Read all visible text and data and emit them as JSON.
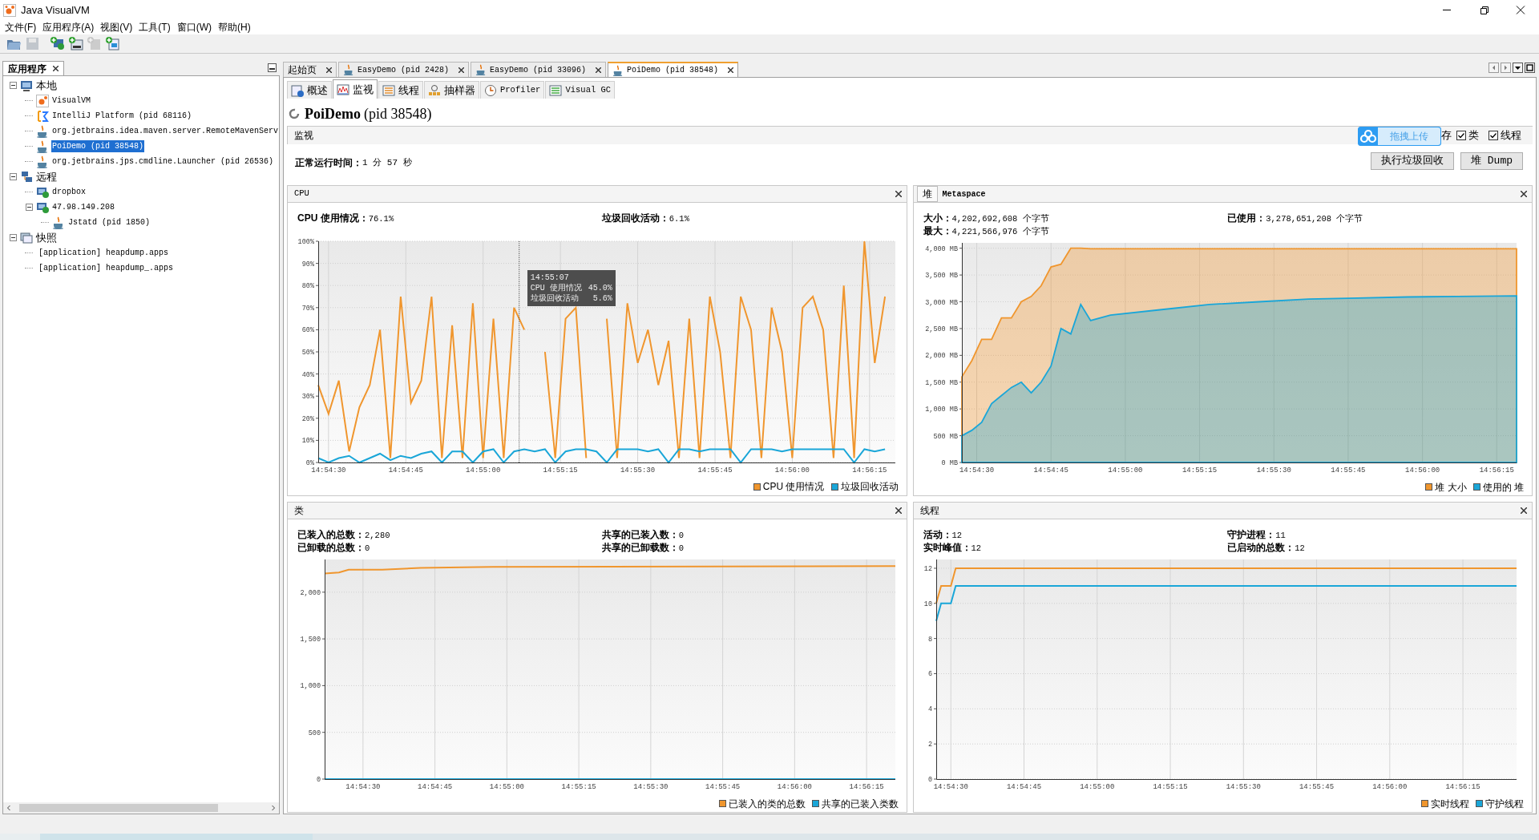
{
  "window": {
    "title": "Java VisualVM"
  },
  "menu": [
    "文件(F)",
    "应用程序(A)",
    "视图(V)",
    "工具(T)",
    "窗口(W)",
    "帮助(H)"
  ],
  "toolbar": [
    {
      "kind": "open",
      "disabled": false
    },
    {
      "kind": "save",
      "disabled": true
    },
    {
      "kind": "add-host",
      "disabled": false
    },
    {
      "kind": "add-jmx",
      "disabled": false
    },
    {
      "kind": "add-dump",
      "disabled": true
    },
    {
      "kind": "add-snapshot",
      "disabled": false
    }
  ],
  "sidebar": {
    "title": "应用程序",
    "tree": [
      {
        "label": "本地",
        "kind": "computer",
        "expanded": true,
        "selected": false,
        "children": [
          {
            "label": "VisualVM",
            "kind": "visualvm",
            "selected": false
          },
          {
            "label": "IntelliJ Platform (pid 68116)",
            "kind": "intellij",
            "selected": false
          },
          {
            "label": "org.jetbrains.idea.maven.server.RemoteMavenServ",
            "kind": "java",
            "selected": false
          },
          {
            "label": "PoiDemo (pid 38548)",
            "kind": "java",
            "selected": true
          },
          {
            "label": "org.jetbrains.jps.cmdline.Launcher (pid 26536)",
            "kind": "java",
            "selected": false
          }
        ]
      },
      {
        "label": "远程",
        "kind": "network",
        "expanded": true,
        "selected": false,
        "children": [
          {
            "label": "dropbox",
            "kind": "host",
            "selected": false
          },
          {
            "label": "47.98.149.208",
            "kind": "host",
            "expanded": true,
            "selected": false,
            "children": [
              {
                "label": "Jstatd (pid 1850)",
                "kind": "java",
                "selected": false
              }
            ]
          }
        ]
      },
      {
        "label": "快照",
        "kind": "snapshots",
        "expanded": true,
        "selected": false,
        "children": [
          {
            "label": "[application] heapdump.apps",
            "kind": "file",
            "selected": false
          },
          {
            "label": "[application] heapdump_.apps",
            "kind": "file",
            "selected": false
          }
        ]
      }
    ]
  },
  "doc_tabs": [
    {
      "label": "起始页",
      "kind": "page",
      "selected": false
    },
    {
      "label": "EasyDemo (pid 2428)",
      "kind": "application",
      "selected": false
    },
    {
      "label": "EasyDemo (pid 33096)",
      "kind": "application",
      "selected": false
    },
    {
      "label": "PoiDemo (pid 38548)",
      "kind": "application",
      "selected": true
    }
  ],
  "view_tabs": [
    {
      "label": "概述",
      "kind": "overview",
      "selected": false
    },
    {
      "label": "监视",
      "kind": "monitor",
      "selected": true
    },
    {
      "label": "线程",
      "kind": "threads",
      "selected": false
    },
    {
      "label": "抽样器",
      "kind": "sampler",
      "selected": false
    },
    {
      "label": "Profiler",
      "kind": "profiler",
      "selected": false
    },
    {
      "label": "Visual GC",
      "kind": "visualgc",
      "selected": false
    }
  ],
  "header": {
    "title": "PoiDemo",
    "subtitle": "(pid 38548)"
  },
  "section": {
    "title": "监视",
    "partial_label": "存",
    "checkboxes": [
      {
        "label": "类",
        "checked": true
      },
      {
        "label": "线程",
        "checked": true
      }
    ]
  },
  "upload_widget": {
    "label": "拖拽上传"
  },
  "uptime": {
    "label": "正常运行时间：",
    "value": "1 分 57 秒"
  },
  "buttons": [
    "执行垃圾回收",
    "堆 Dump"
  ],
  "panels": [
    {
      "title": "CPU",
      "stats": [
        [
          {
            "label": "CPU 使用情况：",
            "value": "76.1%"
          }
        ],
        [
          {
            "label": "垃圾回收活动：",
            "value": "6.1%"
          }
        ]
      ],
      "tooltip": {
        "time": "14:55:07",
        "lines": [
          {
            "label": "CPU 使用情况",
            "value": "45.0%"
          },
          {
            "label": "垃圾回收活动",
            "value": "5.6%"
          }
        ]
      },
      "chart_data": {
        "type": "line",
        "grid": true,
        "ref_lines": [
          {
            "axis": "x",
            "value": 53707
          }
        ],
        "xlim": [
          53668,
          53780
        ],
        "ylim": [
          0,
          100
        ],
        "x": [
          53668,
          53670,
          53672,
          53674,
          53676,
          53678,
          53680,
          53682,
          53684,
          53686,
          53688,
          53690,
          53692,
          53694,
          53696,
          53698,
          53700,
          53702,
          53704,
          53706,
          53708,
          53710,
          53712,
          53714,
          53716,
          53718,
          53720,
          53722,
          53724,
          53726,
          53728,
          53730,
          53732,
          53734,
          53736,
          53738,
          53740,
          53742,
          53744,
          53746,
          53748,
          53750,
          53752,
          53754,
          53756,
          53758,
          53760,
          53762,
          53764,
          53766,
          53768,
          53770,
          53772,
          53774,
          53776,
          53778
        ],
        "xticks": [
          {
            "value": 53670,
            "label": "14:54:30"
          },
          {
            "value": 53685,
            "label": "14:54:45"
          },
          {
            "value": 53700,
            "label": "14:55:00"
          },
          {
            "value": 53715,
            "label": "14:55:15"
          },
          {
            "value": 53730,
            "label": "14:55:30"
          },
          {
            "value": 53745,
            "label": "14:55:45"
          },
          {
            "value": 53760,
            "label": "14:56:00"
          },
          {
            "value": 53775,
            "label": "14:56:15"
          }
        ],
        "yticks": [
          {
            "value": 0,
            "label": "0%"
          },
          {
            "value": 10,
            "label": "10%"
          },
          {
            "value": 20,
            "label": "20%"
          },
          {
            "value": 30,
            "label": "30%"
          },
          {
            "value": 40,
            "label": "40%"
          },
          {
            "value": 50,
            "label": "50%"
          },
          {
            "value": 60,
            "label": "60%"
          },
          {
            "value": 70,
            "label": "70%"
          },
          {
            "value": 80,
            "label": "80%"
          },
          {
            "value": 90,
            "label": "90%"
          },
          {
            "value": 100,
            "label": "100%"
          }
        ],
        "series": [
          {
            "name": "CPU 使用情况",
            "color": "#f0962e",
            "values": [
              35,
              22,
              37,
              5,
              25,
              35,
              60,
              2,
              75,
              27,
              37,
              75,
              2,
              62,
              2,
              72,
              2,
              65,
              2,
              70,
              60,
              null,
              50,
              2,
              65,
              70,
              2,
              null,
              65,
              2,
              72,
              45,
              60,
              35,
              55,
              2,
              65,
              2,
              75,
              50,
              2,
              75,
              60,
              2,
              70,
              50,
              2,
              70,
              75,
              60,
              2,
              80,
              2,
              100,
              45,
              75
            ]
          },
          {
            "name": "垃圾回收活动",
            "color": "#1aa6d8",
            "values": [
              2,
              0,
              2,
              3,
              0,
              2,
              4,
              1,
              3,
              2,
              4,
              5,
              0,
              5,
              5,
              0,
              5,
              6,
              0,
              5,
              6,
              5,
              6,
              0,
              5,
              6,
              6,
              5,
              0,
              6,
              6,
              6,
              5,
              6,
              0,
              6,
              6,
              5,
              6,
              6,
              6,
              0,
              6,
              6,
              6,
              5,
              6,
              6,
              6,
              6,
              6,
              6,
              0,
              6,
              5,
              6
            ]
          }
        ]
      }
    },
    {
      "tabs": [
        {
          "label": "堆",
          "selected": true
        },
        {
          "label": "Metaspace",
          "selected": false
        }
      ],
      "stats": [
        [
          {
            "label": "大小：",
            "value": "4,202,692,608 个字节"
          },
          {
            "label": "最大：",
            "value": "4,221,566,976 个字节"
          }
        ],
        [
          {
            "label": "已使用：",
            "value": "3,278,651,208 个字节"
          }
        ]
      ],
      "chart_data": {
        "type": "area",
        "grid": true,
        "xlim": [
          53667,
          53779
        ],
        "ylim": [
          0,
          4100
        ],
        "x": [
          53667,
          53669,
          53671,
          53673,
          53675,
          53677,
          53679,
          53681,
          53683,
          53685,
          53687,
          53689,
          53691,
          53693,
          53697,
          53707,
          53717,
          53727,
          53737,
          53747,
          53757,
          53767,
          53779
        ],
        "xticks": [
          {
            "value": 53670,
            "label": "14:54:30"
          },
          {
            "value": 53685,
            "label": "14:54:45"
          },
          {
            "value": 53700,
            "label": "14:55:00"
          },
          {
            "value": 53715,
            "label": "14:55:15"
          },
          {
            "value": 53730,
            "label": "14:55:30"
          },
          {
            "value": 53745,
            "label": "14:55:45"
          },
          {
            "value": 53760,
            "label": "14:56:00"
          },
          {
            "value": 53775,
            "label": "14:56:15"
          }
        ],
        "yticks": [
          {
            "value": 0,
            "label": "0 MB"
          },
          {
            "value": 500,
            "label": "500 MB"
          },
          {
            "value": 1000,
            "label": "1,000 MB"
          },
          {
            "value": 1500,
            "label": "1,500 MB"
          },
          {
            "value": 2000,
            "label": "2,000 MB"
          },
          {
            "value": 2500,
            "label": "2,500 MB"
          },
          {
            "value": 3000,
            "label": "3,000 MB"
          },
          {
            "value": 3500,
            "label": "3,500 MB"
          },
          {
            "value": 4000,
            "label": "4,000 MB"
          }
        ],
        "series": [
          {
            "name": "堆 大小",
            "color": "#f0962e",
            "values": [
              1600,
              1900,
              2300,
              2300,
              2700,
              2700,
              3000,
              3100,
              3300,
              3650,
              3700,
              4000,
              4000,
              3990,
              3990,
              3990,
              3990,
              3990,
              3990,
              3990,
              3990,
              3990,
              3990
            ]
          },
          {
            "name": "使用的 堆",
            "color": "#1aa6d8",
            "values": [
              500,
              600,
              750,
              1100,
              1250,
              1400,
              1500,
              1300,
              1500,
              1800,
              2500,
              2400,
              2950,
              2650,
              2750,
              2850,
              2950,
              3000,
              3050,
              3070,
              3090,
              3100,
              3110
            ]
          }
        ]
      }
    },
    {
      "title": "类",
      "stats": [
        [
          {
            "label": "已装入的总数：",
            "value": "2,280"
          },
          {
            "label": "已卸载的总数：",
            "value": "0"
          }
        ],
        [
          {
            "label": "共享的已装入数：",
            "value": "0"
          },
          {
            "label": "共享的已卸载数：",
            "value": "0"
          }
        ]
      ],
      "chart_data": {
        "type": "line",
        "grid": true,
        "xlim": [
          53662,
          53781
        ],
        "ylim": [
          0,
          2350
        ],
        "x": [
          53662,
          53665,
          53667,
          53674,
          53682,
          53697,
          53781
        ],
        "xticks": [
          {
            "value": 53670,
            "label": "14:54:30"
          },
          {
            "value": 53685,
            "label": "14:54:45"
          },
          {
            "value": 53700,
            "label": "14:55:00"
          },
          {
            "value": 53715,
            "label": "14:55:15"
          },
          {
            "value": 53730,
            "label": "14:55:30"
          },
          {
            "value": 53745,
            "label": "14:55:45"
          },
          {
            "value": 53760,
            "label": "14:56:00"
          },
          {
            "value": 53775,
            "label": "14:56:15"
          }
        ],
        "yticks": [
          {
            "value": 0,
            "label": "0"
          },
          {
            "value": 500,
            "label": "500"
          },
          {
            "value": 1000,
            "label": "1,000"
          },
          {
            "value": 1500,
            "label": "1,500"
          },
          {
            "value": 2000,
            "label": "2,000"
          }
        ],
        "series": [
          {
            "name": "已装入的类的总数",
            "color": "#f0962e",
            "values": [
              2200,
              2210,
              2240,
              2240,
              2260,
              2270,
              2280
            ]
          },
          {
            "name": "共享的已装入类数",
            "color": "#1aa6d8",
            "values": [
              0,
              0,
              0,
              0,
              0,
              0,
              0
            ]
          }
        ]
      }
    },
    {
      "title": "线程",
      "stats": [
        [
          {
            "label": "活动：",
            "value": "12"
          },
          {
            "label": "实时峰值：",
            "value": "12"
          }
        ],
        [
          {
            "label": "守护进程：",
            "value": "11"
          },
          {
            "label": "已启动的总数：",
            "value": "12"
          }
        ]
      ],
      "chart_data": {
        "type": "line",
        "grid": true,
        "xlim": [
          53667,
          53786
        ],
        "ylim": [
          0,
          12.5
        ],
        "x": [
          53667,
          53668,
          53669,
          53670,
          53671,
          53672,
          53786
        ],
        "xticks": [
          {
            "value": 53670,
            "label": "14:54:30"
          },
          {
            "value": 53685,
            "label": "14:54:45"
          },
          {
            "value": 53700,
            "label": "14:55:00"
          },
          {
            "value": 53715,
            "label": "14:55:15"
          },
          {
            "value": 53730,
            "label": "14:55:30"
          },
          {
            "value": 53745,
            "label": "14:55:45"
          },
          {
            "value": 53760,
            "label": "14:56:00"
          },
          {
            "value": 53775,
            "label": "14:56:15"
          }
        ],
        "yticks": [
          0,
          2,
          4,
          6,
          8,
          10,
          12
        ],
        "series": [
          {
            "name": "实时线程",
            "color": "#f0962e",
            "values": [
              10,
              11,
              11,
              11,
              12,
              12,
              12
            ]
          },
          {
            "name": "守护线程",
            "color": "#1aa6d8",
            "values": [
              9,
              10,
              10,
              10,
              11,
              11,
              11
            ]
          }
        ]
      }
    }
  ]
}
